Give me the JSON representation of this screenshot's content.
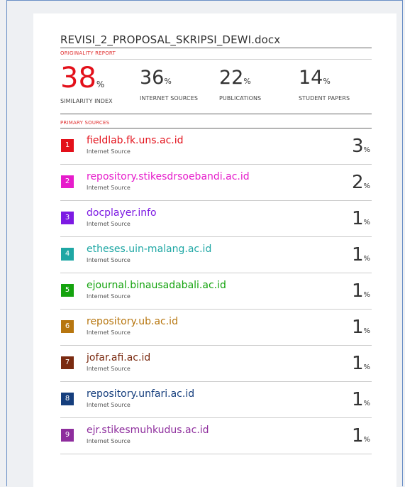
{
  "document": {
    "title": "REVISI_2_PROPOSAL_SKRIPSI_DEWI.docx"
  },
  "originality_report": {
    "heading": "ORIGINALITY REPORT",
    "metrics": [
      {
        "value": "38",
        "unit": "%",
        "label": "SIMILARITY INDEX"
      },
      {
        "value": "36",
        "unit": "%",
        "label": "INTERNET SOURCES"
      },
      {
        "value": "22",
        "unit": "%",
        "label": "PUBLICATIONS"
      },
      {
        "value": "14",
        "unit": "%",
        "label": "STUDENT PAPERS"
      }
    ]
  },
  "primary_sources": {
    "heading": "PRIMARY SOURCES",
    "items": [
      {
        "rank": "1",
        "name": "fieldlab.fk.uns.ac.id",
        "type": "Internet Source",
        "percent": "3",
        "unit": "%",
        "color": "#e3101a"
      },
      {
        "rank": "2",
        "name": "repository.stikesdrsoebandi.ac.id",
        "type": "Internet Source",
        "percent": "2",
        "unit": "%",
        "color": "#e61ccb"
      },
      {
        "rank": "3",
        "name": "docplayer.info",
        "type": "Internet Source",
        "percent": "1",
        "unit": "%",
        "color": "#7d1ae3"
      },
      {
        "rank": "4",
        "name": "etheses.uin-malang.ac.id",
        "type": "Internet Source",
        "percent": "1",
        "unit": "%",
        "color": "#1ea7a4"
      },
      {
        "rank": "5",
        "name": "ejournal.binausadabali.ac.id",
        "type": "Internet Source",
        "percent": "1",
        "unit": "%",
        "color": "#14a30e"
      },
      {
        "rank": "6",
        "name": "repository.ub.ac.id",
        "type": "Internet Source",
        "percent": "1",
        "unit": "%",
        "color": "#b7760f"
      },
      {
        "rank": "7",
        "name": "jofar.afi.ac.id",
        "type": "Internet Source",
        "percent": "1",
        "unit": "%",
        "color": "#7a2a10"
      },
      {
        "rank": "8",
        "name": "repository.unfari.ac.id",
        "type": "Internet Source",
        "percent": "1",
        "unit": "%",
        "color": "#153e7d"
      },
      {
        "rank": "9",
        "name": "ejr.stikesmuhkudus.ac.id",
        "type": "Internet Source",
        "percent": "1",
        "unit": "%",
        "color": "#8e2d9d"
      }
    ]
  }
}
